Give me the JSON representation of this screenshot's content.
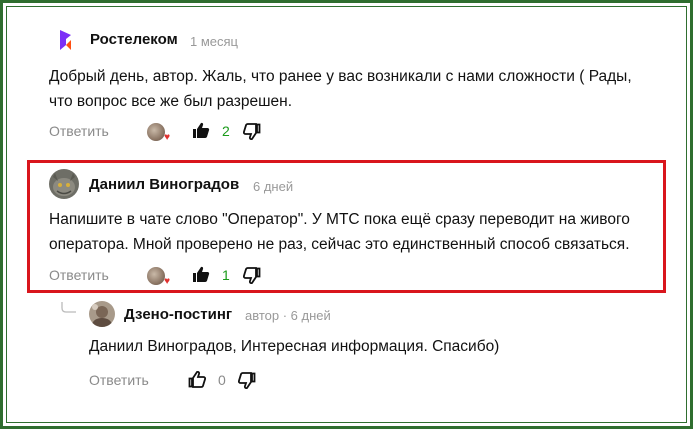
{
  "comments": [
    {
      "author": "Ростелеком",
      "time": "1 месяц",
      "text_lines": [
        "Добрый день, автор. Жаль, что ранее у вас возникали с нами сложности ( Рады,",
        "что вопрос все же был разрешен."
      ],
      "reply_label": "Ответить",
      "likes": "2",
      "liked": true
    },
    {
      "author": "Даниил Виноградов",
      "time": "6 дней",
      "text_lines": [
        "Напишите в чате слово \"Оператор\". У МТС пока ещё сразу переводит на живого",
        "оператора. Мной проверено не раз, сейчас это единственный способ связаться."
      ],
      "reply_label": "Ответить",
      "likes": "1",
      "liked": true
    },
    {
      "author": "Дзено-постинг",
      "time": "автор · 6 дней",
      "text_lines": [
        "Даниил Виноградов, Интересная информация. Спасибо)"
      ],
      "reply_label": "Ответить",
      "likes": "0",
      "liked": false
    }
  ],
  "colors": {
    "frame": "#2f6e2f",
    "highlight": "#d9161d",
    "like_count": "#1a9b1a",
    "rostelecom_logo": "#7b2ff7"
  },
  "icons": [
    "rostelecom-logo-icon",
    "thumbs-up-icon",
    "thumbs-down-icon",
    "heart-icon",
    "reply-thread-icon"
  ]
}
